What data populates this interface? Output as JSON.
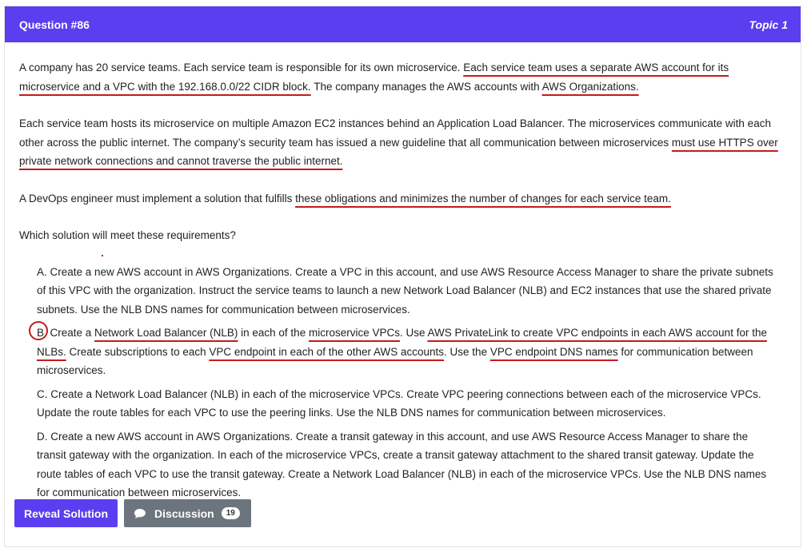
{
  "header": {
    "question": "Question #86",
    "topic": "Topic 1"
  },
  "question": {
    "p1": [
      "A company has 20 service teams. Each service team is responsible for its own microservice. ",
      "Each service team uses a separate AWS account for its microservice and a VPC with the 192.168.0.0/22 CIDR block.",
      " The company manages the AWS accounts with ",
      "AWS Organizations."
    ],
    "p2": [
      "Each service team hosts its microservice on multiple Amazon EC2 instances behind an Application Load Balancer. The microservices communicate with each other across the public internet. The company’s security team has issued a new guideline that all communication between microservices ",
      "must use HTTPS over private network connections and cannot traverse the public internet."
    ],
    "p3": [
      "A DevOps engineer must implement a solution that fulfills ",
      "these obligations and minimizes the number of changes for each service team."
    ],
    "p4": "Which solution will meet these requirements?"
  },
  "choices": {
    "a": "A. Create a new AWS account in AWS Organizations. Create a VPC in this account, and use AWS Resource Access Manager to share the private subnets of this VPC with the organization. Instruct the service teams to launch a new Network Load Balancer (NLB) and EC2 instances that use the shared private subnets. Use the NLB DNS names for communication between microservices.",
    "b": [
      "B.",
      " Create a ",
      "Network Load Balancer (NLB)",
      " in each of the ",
      "microservice VPCs",
      ". Use ",
      "AWS PrivateLink to create VPC endpoints in each AWS account for the NLBs.",
      " Create subscriptions to each ",
      "VPC endpoint in each of the other AWS accounts",
      ". Use the ",
      "VPC endpoint DNS names",
      " for communication between microservices."
    ],
    "c": "C. Create a Network Load Balancer (NLB) in each of the microservice VPCs. Create VPC peering connections between each of the microservice VPCs. Update the route tables for each VPC to use the peering links. Use the NLB DNS names for communication between microservices.",
    "d": "D. Create a new AWS account in AWS Organizations. Create a transit gateway in this account, and use AWS Resource Access Manager to share the transit gateway with the organization. In each of the microservice VPCs, create a transit gateway attachment to the shared transit gateway. Update the route tables of each VPC to use the transit gateway. Create a Network Load Balancer (NLB) in each of the microservice VPCs. Use the NLB DNS names for communication between microservices."
  },
  "buttons": {
    "reveal": "Reveal Solution",
    "discussion": "Discussion",
    "discussion_count": "19",
    "discussion_icon": "chat-bubble-icon"
  },
  "colors": {
    "accent": "#5a3ef0",
    "annotation": "#c41a1a",
    "secondary_button": "#6c757d"
  }
}
